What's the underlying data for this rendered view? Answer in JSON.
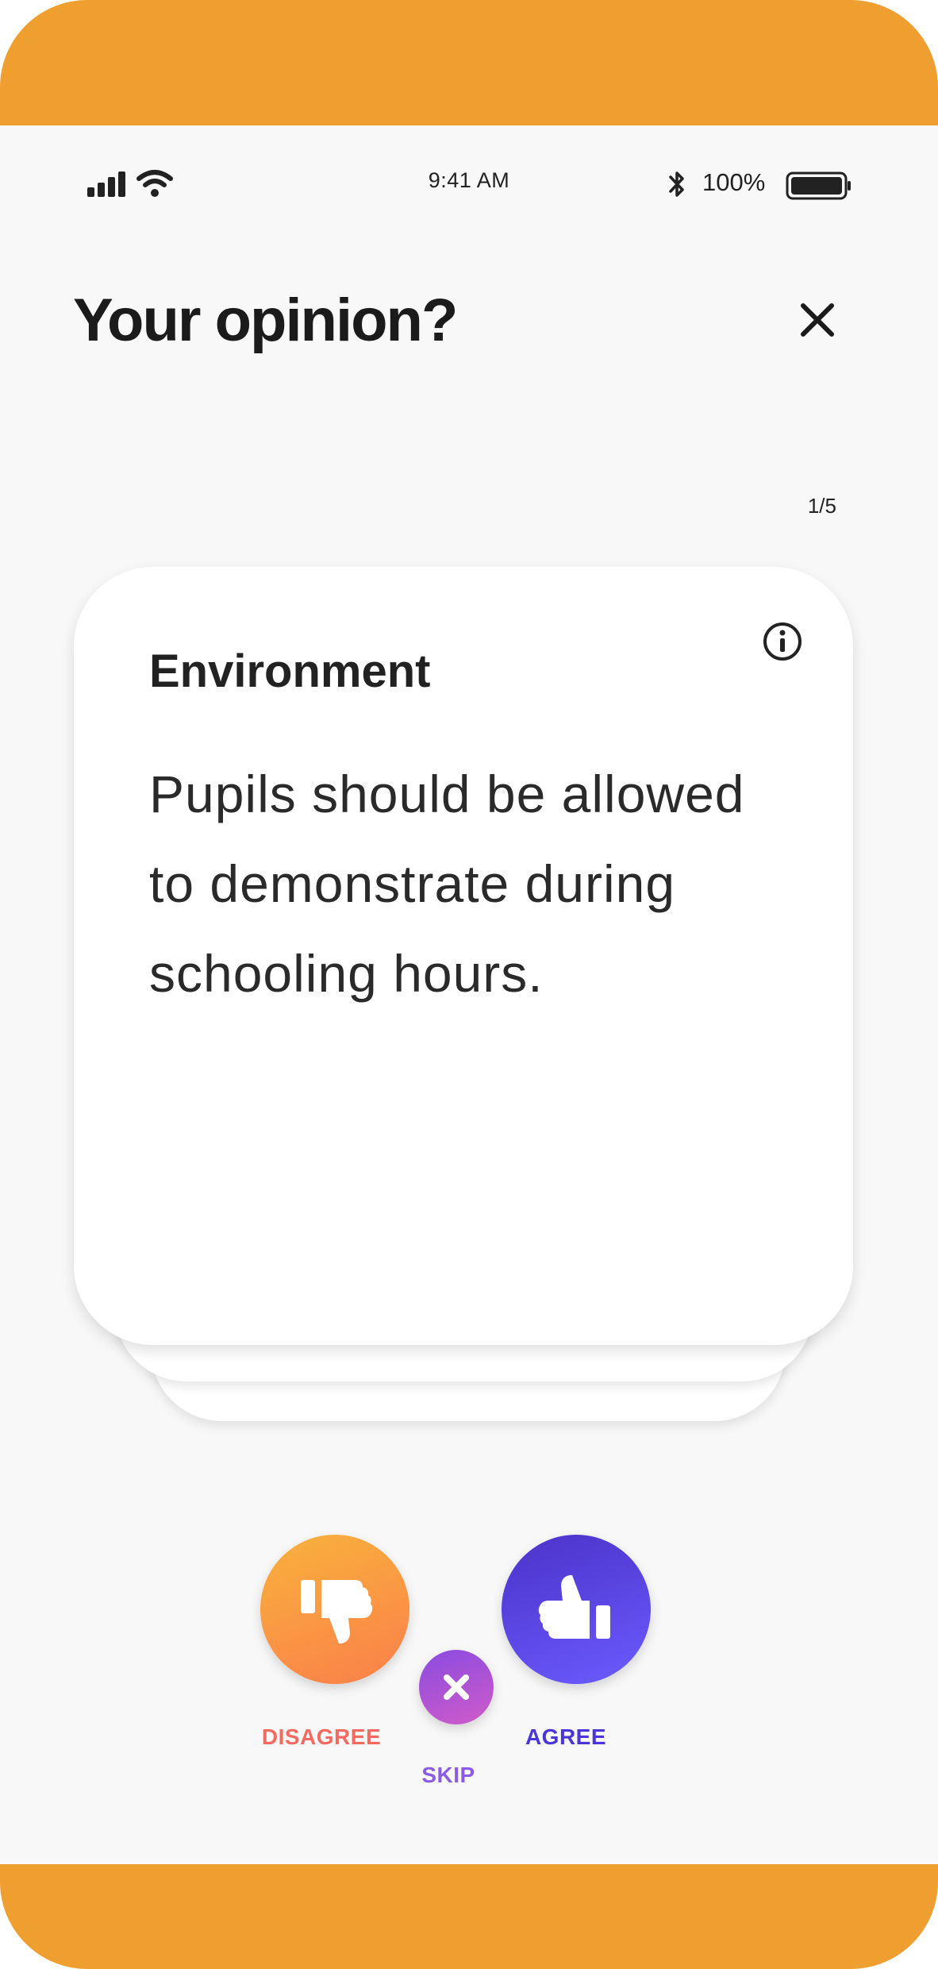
{
  "status_bar": {
    "time": "9:41 AM",
    "battery_percent": "100%",
    "icons": [
      "cellular-signal-icon",
      "wifi-icon",
      "bluetooth-icon",
      "battery-icon"
    ]
  },
  "header": {
    "title": "Your opinion?",
    "close_icon": "close-icon"
  },
  "progress": {
    "label": "1/5"
  },
  "card": {
    "category": "Environment",
    "statement": "Pupils should be allowed to demonstrate during schooling hours.",
    "info_icon": "info-icon"
  },
  "actions": {
    "disagree_label": "DISAGREE",
    "skip_label": "SKIP",
    "agree_label": "AGREE"
  },
  "colors": {
    "accent_orange": "#ef9f30",
    "disagree_gradient_start": "#f8b23c",
    "disagree_gradient_end": "#fb7f4a",
    "agree_gradient_start": "#4b32c8",
    "agree_gradient_end": "#6b5bff",
    "skip_gradient_start": "#8a4be0",
    "skip_gradient_end": "#d05bc9",
    "disagree_text": "#f46a5f",
    "agree_text": "#4a35d8",
    "skip_text": "#8a5be6"
  }
}
